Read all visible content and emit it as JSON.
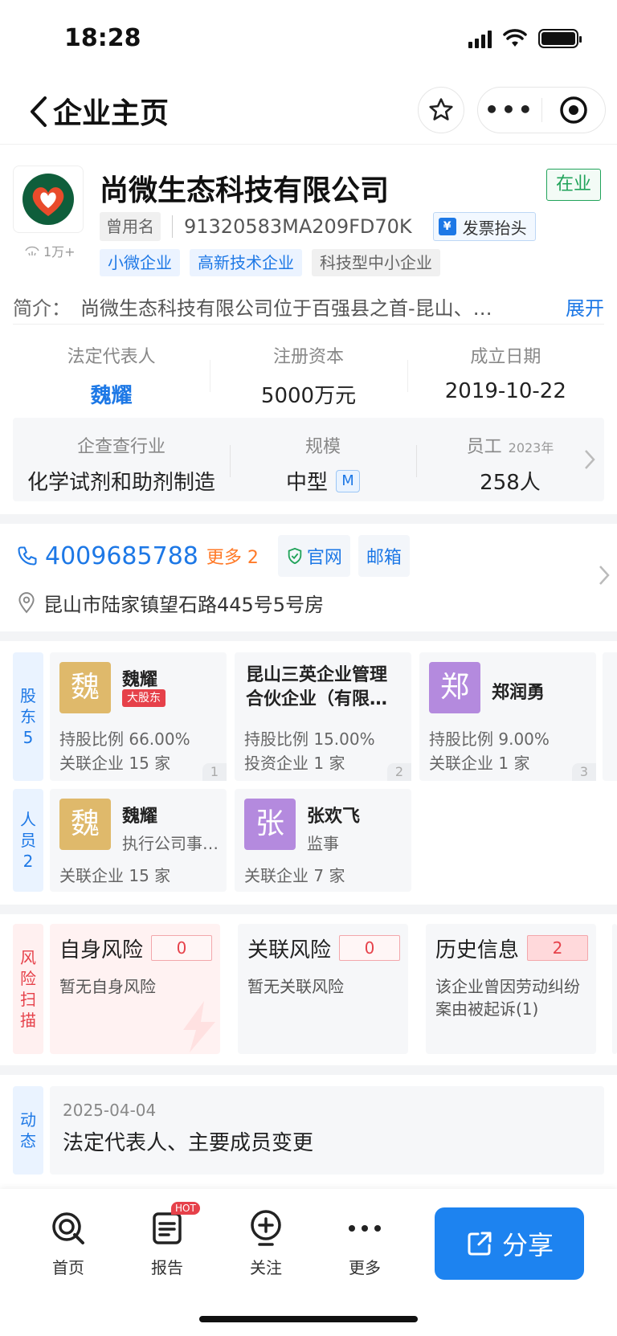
{
  "status_bar": {
    "time": "18:28"
  },
  "nav": {
    "title": "企业主页"
  },
  "company": {
    "name": "尚微生态科技有限公司",
    "status": "在业",
    "former_name_label": "曾用名",
    "credit_code": "91320583MA209FD70K",
    "invoice_label": "发票抬头",
    "views": "1万+",
    "tags": [
      "小微企业",
      "高新技术企业",
      "科技型中小企业"
    ],
    "intro_label": "简介：",
    "intro_text": "尚微生态科技有限公司位于百强县之首-昆山、…",
    "expand_label": "展开"
  },
  "stats1": [
    {
      "key": "法定代表人",
      "value": "魏耀"
    },
    {
      "key": "注册资本",
      "value": "5000万元"
    },
    {
      "key": "成立日期",
      "value": "2019-10-22"
    }
  ],
  "stats2": {
    "industry": {
      "key": "企查查行业",
      "value": "化学试剂和助剂制造"
    },
    "scale": {
      "key": "规模",
      "value": "中型",
      "badge": "M"
    },
    "staff": {
      "key": "员工",
      "year": "2023年",
      "value": "258人"
    }
  },
  "contact": {
    "phone": "4009685788",
    "more": "更多 2",
    "website": "官网",
    "email": "邮箱",
    "address": "昆山市陆家镇望石路445号5号房"
  },
  "shareholders": {
    "tab": [
      "股",
      "东",
      "5"
    ],
    "items": [
      {
        "avatar": "魏",
        "name": "魏耀",
        "badge": "大股东",
        "line1": "持股比例 66.00%",
        "line2": "关联企业 15 家",
        "index": "1"
      },
      {
        "name": "昆山三英企业管理合伙企业（有限…",
        "line1": "持股比例 15.00%",
        "line2": "投资企业 1 家",
        "index": "2"
      },
      {
        "avatar": "郑",
        "name": "郑润勇",
        "line1": "持股比例 9.00%",
        "line2": "关联企业 1 家",
        "index": "3"
      }
    ]
  },
  "persons": {
    "tab": [
      "人",
      "员",
      "2"
    ],
    "items": [
      {
        "avatar": "魏",
        "name": "魏耀",
        "role": "执行公司事…",
        "line": "关联企业 15 家"
      },
      {
        "avatar": "张",
        "name": "张欢飞",
        "role": "监事",
        "line": "关联企业 7 家"
      }
    ]
  },
  "risk": {
    "tab": [
      "风",
      "险",
      "扫",
      "描"
    ],
    "items": [
      {
        "title": "自身风险",
        "count": "0",
        "desc": "暂无自身风险"
      },
      {
        "title": "关联风险",
        "count": "0",
        "desc": "暂无关联风险"
      },
      {
        "title": "历史信息",
        "count": "2",
        "desc": "该企业曾因劳动纠纷案由被起诉(1)"
      }
    ]
  },
  "dynamic": {
    "tab": [
      "动",
      "态"
    ],
    "date": "2025-04-04",
    "text": "法定代表人、主要成员变更"
  },
  "bottom_bar": {
    "tabs": [
      {
        "label": "首页",
        "icon": "home-logo-icon"
      },
      {
        "label": "报告",
        "icon": "report-icon",
        "badge": "HOT"
      },
      {
        "label": "关注",
        "icon": "follow-plus-icon"
      },
      {
        "label": "更多",
        "icon": "more-dots-icon"
      }
    ],
    "share_label": "分享"
  },
  "colors": {
    "accent": "#1d78e6",
    "danger": "#e6414a",
    "success": "#21a35a",
    "orange": "#ff7a28"
  }
}
